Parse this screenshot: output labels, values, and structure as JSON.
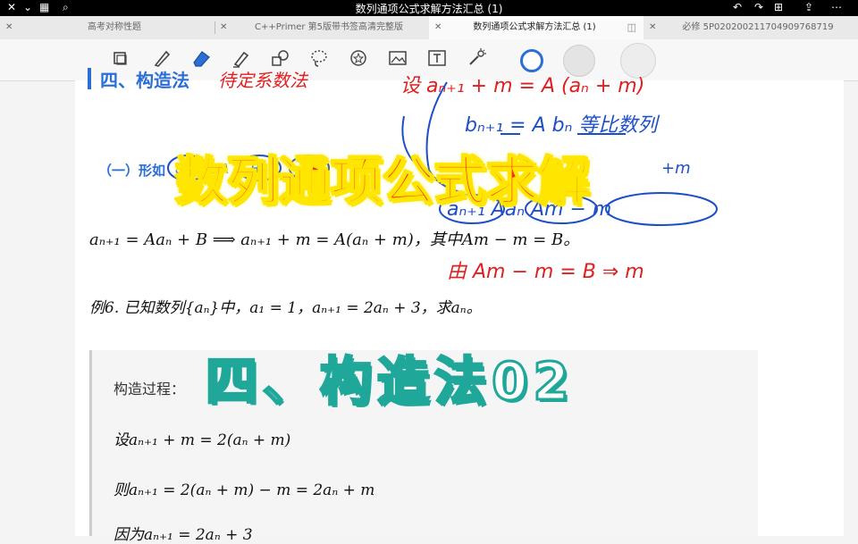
{
  "titlebar": {
    "title": "数列通项公式求解方法汇总 (1)"
  },
  "tabs": [
    {
      "label": "高考对称性题"
    },
    {
      "label": "C++Primer 第5版带书签高清完整版"
    },
    {
      "label": "数列通项公式求解方法汇总 (1)"
    },
    {
      "label": "必修 5P020200211704909768719"
    }
  ],
  "doc": {
    "section_heading": "四、构造法",
    "handwritten_heading": "待定系数法",
    "subheading": "（一）形如",
    "subheading_formula": "a_n ... A ... B",
    "line1": "aₙ₊₁ = Aaₙ + B ⟹ aₙ₊₁ + m = A(aₙ + m)，其中Am − m = B。",
    "example": "例6. 已知数列{aₙ}中，a₁ = 1，aₙ₊₁ = 2aₙ + 3，求aₙ。",
    "box": {
      "title": "构造过程：",
      "step1": "设aₙ₊₁ + m = 2(aₙ + m)",
      "step2": "则aₙ₊₁ = 2(aₙ + m) − m = 2aₙ + m",
      "step3": "因为aₙ₊₁ = 2aₙ + 3"
    }
  },
  "handwriting": {
    "h1": "设 aₙ₊₁ + m = A (aₙ + m)",
    "h2": "bₙ₊₁  = A bₙ  等比数列",
    "h3": "aₙ₊₁   Aaₙ   Am − m",
    "h4": "由 Am − m = B ⇒ m",
    "h5": "+m"
  },
  "overlay": {
    "title": "数列通项公式求解",
    "subtitle": "四、构造法02"
  },
  "colors": {
    "accent": "#2b6fd6",
    "red": "#e02020",
    "blue_ink": "#1d4ec9",
    "title_red": "#ff2a1a",
    "title_yellow": "#ffe600",
    "subtitle_teal": "#1fa89a"
  }
}
